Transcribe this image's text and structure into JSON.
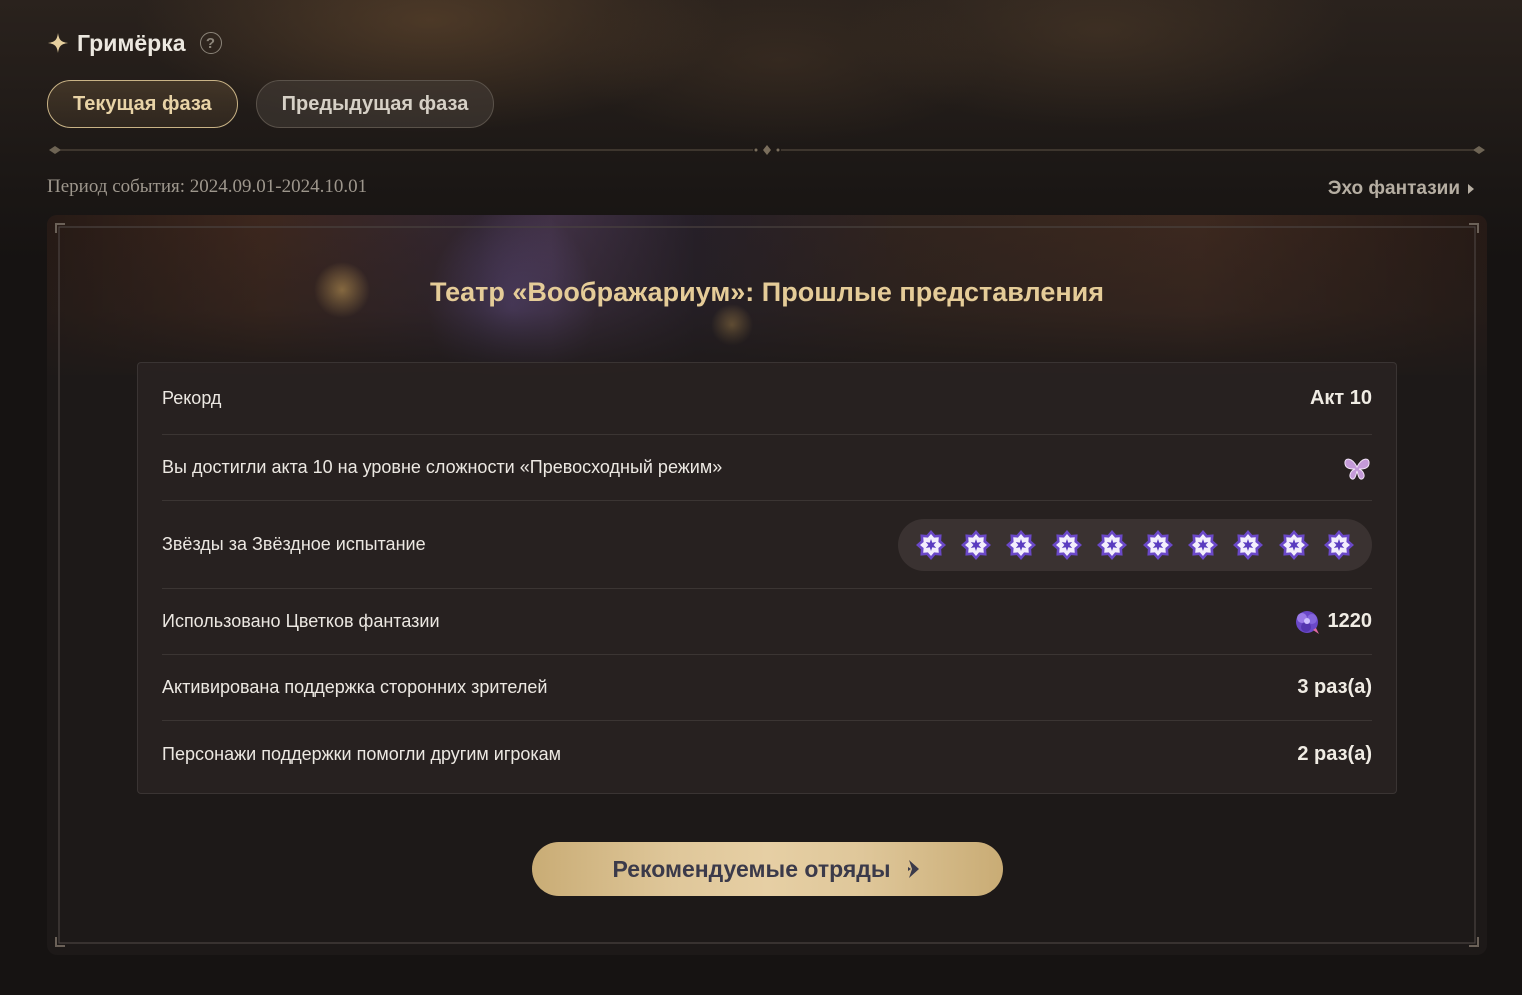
{
  "header": {
    "title": "Гримёрка",
    "icon": "sparkle-icon",
    "help_icon": "help-circle-icon"
  },
  "tabs": [
    {
      "label": "Текущая фаза",
      "active": true
    },
    {
      "label": "Предыдущая фаза",
      "active": false
    }
  ],
  "period": "Период события: 2024.09.01-2024.10.01",
  "echo_link": "Эхо фантазии",
  "card": {
    "title": "Театр «Воображариум»: Прошлые представления",
    "rows": {
      "record": {
        "label": "Рекорд",
        "value": "Акт 10"
      },
      "difficulty": {
        "label": "Вы достигли акта 10 на уровне сложности «Превосходный режим»",
        "icon": "butterfly-icon"
      },
      "stars": {
        "label": "Звёзды за Звёздное испытание",
        "count": 10,
        "icon": "medal-star-icon"
      },
      "flowers": {
        "label": "Использовано Цветков фантазии",
        "value": "1220",
        "icon": "fantasy-flower-icon"
      },
      "audience": {
        "label": "Активирована поддержка сторонних зрителей",
        "value": "3 раз(а)"
      },
      "support": {
        "label": "Персонажи поддержки помогли другим игрокам",
        "value": "2 раз(а)"
      }
    },
    "button": {
      "label": "Рекомендуемые отряды",
      "icon": "arrow-right-icon"
    }
  },
  "colors": {
    "accent_gold": "#e5cc98",
    "button_gold": "#dfc79a",
    "star_purple": "#6a48c8"
  }
}
